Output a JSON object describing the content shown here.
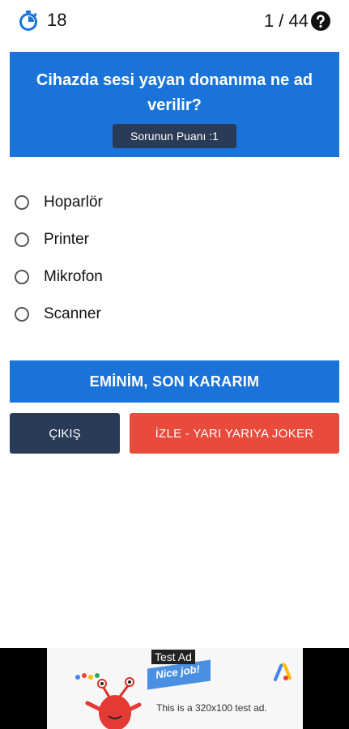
{
  "header": {
    "timer_value": "18",
    "progress": "1 / 44",
    "icons": {
      "timer": "stopwatch-icon",
      "help": "help-circle-icon"
    }
  },
  "question": {
    "text": "Cihazda sesi yayan donanıma ne ad verilir?",
    "points_label": "Sorunun Puanı :1"
  },
  "options": [
    {
      "label": "Hoparlör",
      "selected": false
    },
    {
      "label": "Printer",
      "selected": false
    },
    {
      "label": "Mikrofon",
      "selected": false
    },
    {
      "label": "Scanner",
      "selected": false
    }
  ],
  "actions": {
    "confirm_label": "EMİNİM, SON KARARIM",
    "exit_label": "ÇIKIŞ",
    "joker_label": "İZLE - YARI YARIYA JOKER"
  },
  "ad": {
    "label": "Test Ad",
    "banner_text": "Nice job!",
    "description": "This is a 320x100 test ad."
  },
  "colors": {
    "primary": "#1a73d9",
    "dark": "#2a3b57",
    "danger": "#e84a3c"
  }
}
